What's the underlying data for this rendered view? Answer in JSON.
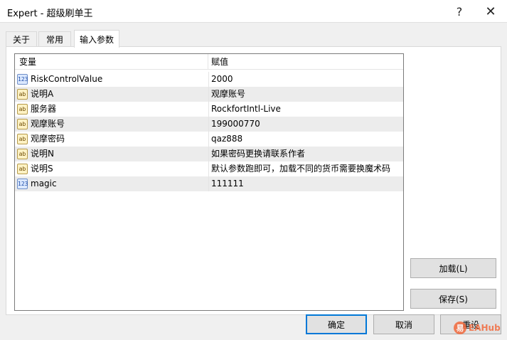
{
  "window": {
    "title": "Expert - 超级刷单王"
  },
  "titlebar": {
    "help": "?",
    "close": "✕"
  },
  "tabs": [
    {
      "label": "关于"
    },
    {
      "label": "常用"
    },
    {
      "label": "输入参数"
    }
  ],
  "grid": {
    "headers": {
      "variable": "变量",
      "value": "赋值"
    },
    "rows": [
      {
        "type": "num",
        "name": "RiskControlValue",
        "value": "2000"
      },
      {
        "type": "str",
        "name": "说明A",
        "value": "观摩账号"
      },
      {
        "type": "str",
        "name": "服务器",
        "value": "RockfortIntl-Live"
      },
      {
        "type": "str",
        "name": "观摩账号",
        "value": "199000770"
      },
      {
        "type": "str",
        "name": "观摩密码",
        "value": "qaz888"
      },
      {
        "type": "str",
        "name": "说明N",
        "value": "如果密码更换请联系作者"
      },
      {
        "type": "str",
        "name": "说明S",
        "value": "默认参数跑即可，加载不同的货币需要换魔术码"
      },
      {
        "type": "num",
        "name": "magic",
        "value": "111111"
      }
    ],
    "type_icons": {
      "num": "123",
      "str": "ab"
    }
  },
  "buttons": {
    "load": "加载(L)",
    "save": "保存(S)",
    "ok": "确定",
    "cancel": "取消",
    "reset": "重设"
  },
  "watermark": {
    "logo": "易",
    "text": "EAHub"
  },
  "colors": {
    "accent": "#0078d7",
    "row_alt": "#ececec",
    "watermark": "#f26a3d"
  }
}
